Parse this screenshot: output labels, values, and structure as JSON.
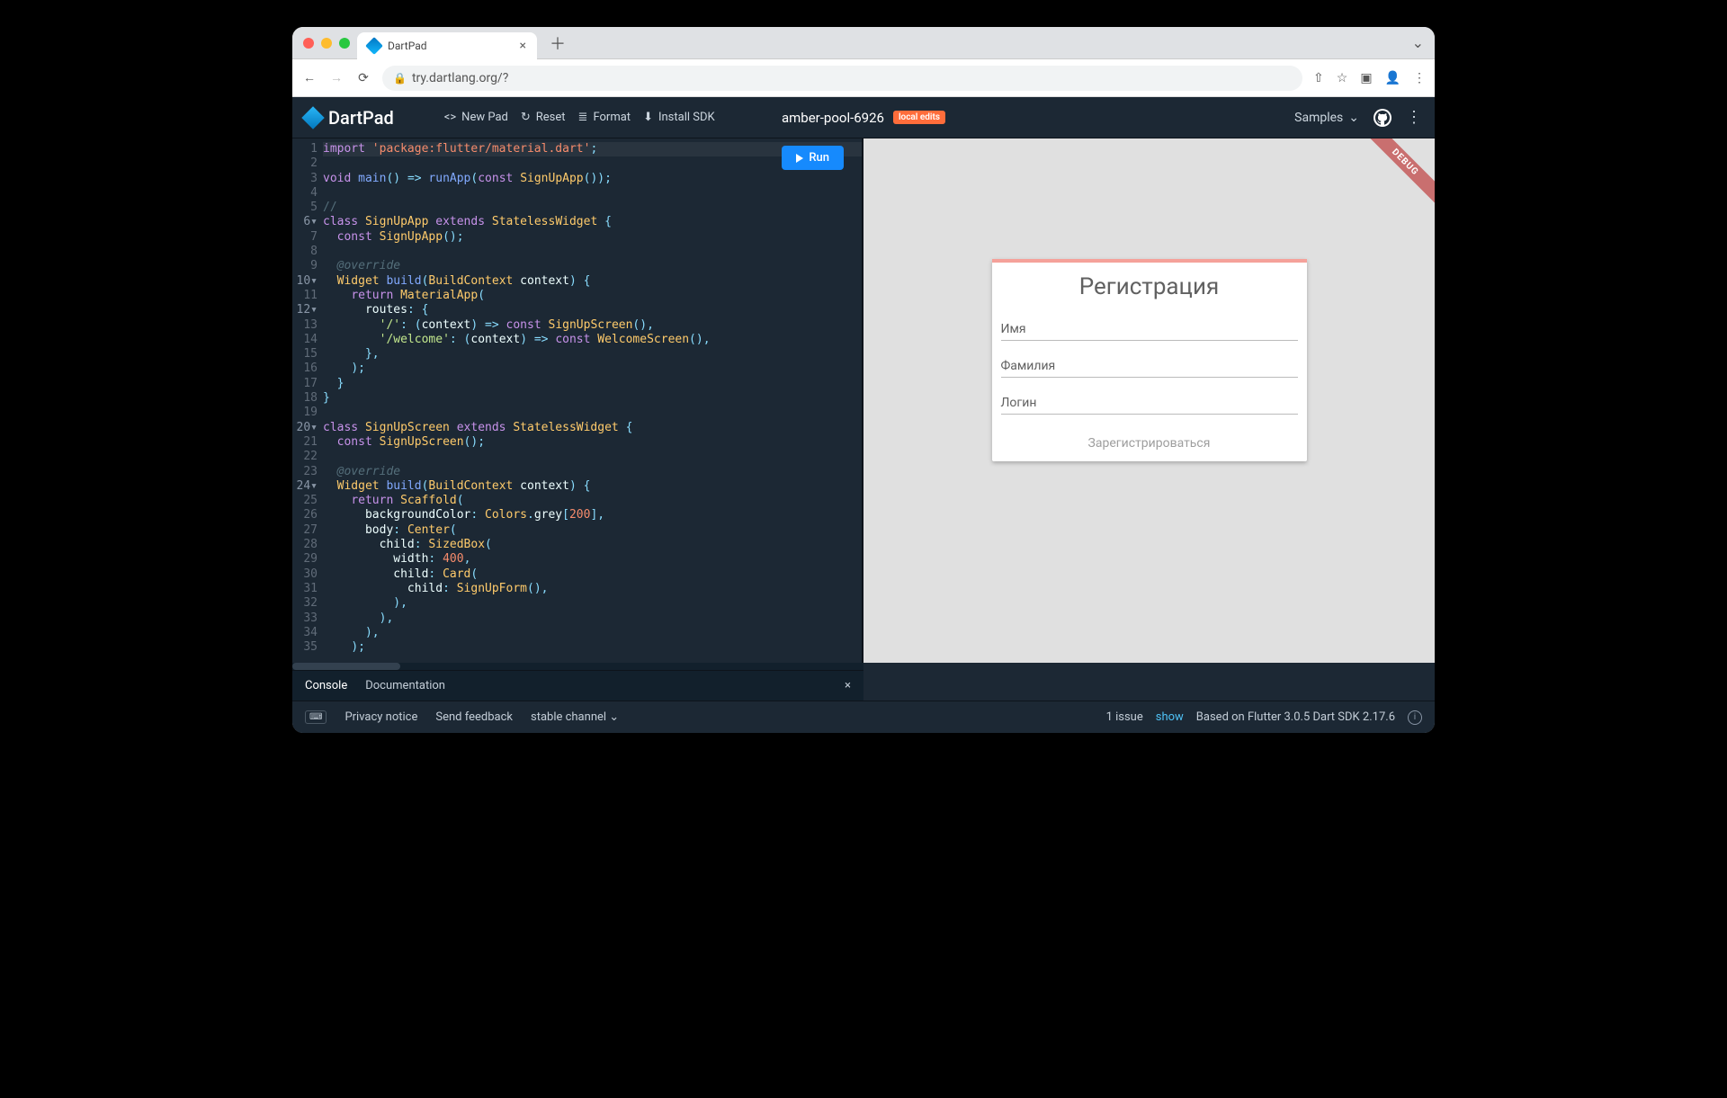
{
  "browser": {
    "tab_title": "DartPad",
    "url_display": "try.dartlang.org/?"
  },
  "toolbar": {
    "app_name": "DartPad",
    "new_pad": "New Pad",
    "reset": "Reset",
    "format": "Format",
    "install_sdk": "Install SDK",
    "project_name": "amber-pool-6926",
    "local_edits_badge": "local edits",
    "samples": "Samples",
    "run_label": "Run"
  },
  "editor": {
    "line_count": 35,
    "fold_lines": [
      6,
      10,
      12,
      20,
      24
    ],
    "code_lines": [
      {
        "raw": "import 'package:flutter/material.dart';",
        "seg": [
          [
            "kw",
            "import "
          ],
          [
            "strimp",
            "'package:flutter/material.dart'"
          ],
          [
            "pun",
            ";"
          ]
        ]
      },
      {
        "raw": ""
      },
      {
        "raw": "void main() => runApp(const SignUpApp());",
        "seg": [
          [
            "kw",
            "void "
          ],
          [
            "fn",
            "main"
          ],
          [
            "pun",
            "() "
          ],
          [
            "pun",
            "=> "
          ],
          [
            "fn",
            "runApp"
          ],
          [
            "pun",
            "("
          ],
          [
            "kw",
            "const "
          ],
          [
            "typ",
            "SignUpApp"
          ],
          [
            "pun",
            "());"
          ]
        ]
      },
      {
        "raw": ""
      },
      {
        "raw": "//",
        "seg": [
          [
            "cmt",
            "//"
          ]
        ]
      },
      {
        "raw": "class SignUpApp extends StatelessWidget {",
        "seg": [
          [
            "kw",
            "class "
          ],
          [
            "typ",
            "SignUpApp "
          ],
          [
            "kw",
            "extends "
          ],
          [
            "typ",
            "StatelessWidget "
          ],
          [
            "pun",
            "{"
          ]
        ]
      },
      {
        "raw": "  const SignUpApp();",
        "seg": [
          [
            "id",
            "  "
          ],
          [
            "kw",
            "const "
          ],
          [
            "typ",
            "SignUpApp"
          ],
          [
            "pun",
            "();"
          ]
        ]
      },
      {
        "raw": ""
      },
      {
        "raw": "  @override",
        "seg": [
          [
            "id",
            "  "
          ],
          [
            "ann",
            "@override"
          ]
        ]
      },
      {
        "raw": "  Widget build(BuildContext context) {",
        "seg": [
          [
            "id",
            "  "
          ],
          [
            "typ",
            "Widget "
          ],
          [
            "fn",
            "build"
          ],
          [
            "pun",
            "("
          ],
          [
            "typ",
            "BuildContext "
          ],
          [
            "id",
            "context"
          ],
          [
            "pun",
            ") {"
          ]
        ]
      },
      {
        "raw": "    return MaterialApp(",
        "seg": [
          [
            "id",
            "    "
          ],
          [
            "kw",
            "return "
          ],
          [
            "typ",
            "MaterialApp"
          ],
          [
            "pun",
            "("
          ]
        ]
      },
      {
        "raw": "      routes: {",
        "seg": [
          [
            "id",
            "      "
          ],
          [
            "id",
            "routes"
          ],
          [
            "pun",
            ": {"
          ]
        ]
      },
      {
        "raw": "        '/': (context) => const SignUpScreen(),",
        "seg": [
          [
            "id",
            "        "
          ],
          [
            "str",
            "'/'"
          ],
          [
            "pun",
            ": ("
          ],
          [
            "id",
            "context"
          ],
          [
            "pun",
            ") "
          ],
          [
            "pun",
            "=> "
          ],
          [
            "kw",
            "const "
          ],
          [
            "typ",
            "SignUpScreen"
          ],
          [
            "pun",
            "(),"
          ]
        ]
      },
      {
        "raw": "        '/welcome': (context) => const WelcomeScreen(),",
        "seg": [
          [
            "id",
            "        "
          ],
          [
            "str",
            "'/welcome'"
          ],
          [
            "pun",
            ": ("
          ],
          [
            "id",
            "context"
          ],
          [
            "pun",
            ") "
          ],
          [
            "pun",
            "=> "
          ],
          [
            "kw",
            "const "
          ],
          [
            "typ",
            "WelcomeScreen"
          ],
          [
            "pun",
            "(),"
          ]
        ]
      },
      {
        "raw": "      },",
        "seg": [
          [
            "id",
            "      "
          ],
          [
            "pun",
            "},"
          ]
        ]
      },
      {
        "raw": "    );",
        "seg": [
          [
            "id",
            "    "
          ],
          [
            "pun",
            ");"
          ]
        ]
      },
      {
        "raw": "  }",
        "seg": [
          [
            "id",
            "  "
          ],
          [
            "pun",
            "}"
          ]
        ]
      },
      {
        "raw": "}",
        "seg": [
          [
            "pun",
            "}"
          ]
        ]
      },
      {
        "raw": ""
      },
      {
        "raw": "class SignUpScreen extends StatelessWidget {",
        "seg": [
          [
            "kw",
            "class "
          ],
          [
            "typ",
            "SignUpScreen "
          ],
          [
            "kw",
            "extends "
          ],
          [
            "typ",
            "StatelessWidget "
          ],
          [
            "pun",
            "{"
          ]
        ]
      },
      {
        "raw": "  const SignUpScreen();",
        "seg": [
          [
            "id",
            "  "
          ],
          [
            "kw",
            "const "
          ],
          [
            "typ",
            "SignUpScreen"
          ],
          [
            "pun",
            "();"
          ]
        ]
      },
      {
        "raw": ""
      },
      {
        "raw": "  @override",
        "seg": [
          [
            "id",
            "  "
          ],
          [
            "ann",
            "@override"
          ]
        ]
      },
      {
        "raw": "  Widget build(BuildContext context) {",
        "seg": [
          [
            "id",
            "  "
          ],
          [
            "typ",
            "Widget "
          ],
          [
            "fn",
            "build"
          ],
          [
            "pun",
            "("
          ],
          [
            "typ",
            "BuildContext "
          ],
          [
            "id",
            "context"
          ],
          [
            "pun",
            ") {"
          ]
        ]
      },
      {
        "raw": "    return Scaffold(",
        "seg": [
          [
            "id",
            "    "
          ],
          [
            "kw",
            "return "
          ],
          [
            "typ",
            "Scaffold"
          ],
          [
            "pun",
            "("
          ]
        ]
      },
      {
        "raw": "      backgroundColor: Colors.grey[200],",
        "seg": [
          [
            "id",
            "      "
          ],
          [
            "id",
            "backgroundColor"
          ],
          [
            "pun",
            ": "
          ],
          [
            "typ",
            "Colors"
          ],
          [
            "pun",
            "."
          ],
          [
            "id",
            "grey"
          ],
          [
            "pun",
            "["
          ],
          [
            "num",
            "200"
          ],
          [
            "pun",
            "],"
          ]
        ]
      },
      {
        "raw": "      body: Center(",
        "seg": [
          [
            "id",
            "      "
          ],
          [
            "id",
            "body"
          ],
          [
            "pun",
            ": "
          ],
          [
            "typ",
            "Center"
          ],
          [
            "pun",
            "("
          ]
        ]
      },
      {
        "raw": "        child: SizedBox(",
        "seg": [
          [
            "id",
            "        "
          ],
          [
            "id",
            "child"
          ],
          [
            "pun",
            ": "
          ],
          [
            "typ",
            "SizedBox"
          ],
          [
            "pun",
            "("
          ]
        ]
      },
      {
        "raw": "          width: 400,",
        "seg": [
          [
            "id",
            "          "
          ],
          [
            "id",
            "width"
          ],
          [
            "pun",
            ": "
          ],
          [
            "num",
            "400"
          ],
          [
            "pun",
            ","
          ]
        ]
      },
      {
        "raw": "          child: Card(",
        "seg": [
          [
            "id",
            "          "
          ],
          [
            "id",
            "child"
          ],
          [
            "pun",
            ": "
          ],
          [
            "typ",
            "Card"
          ],
          [
            "pun",
            "("
          ]
        ]
      },
      {
        "raw": "            child: SignUpForm(),",
        "seg": [
          [
            "id",
            "            "
          ],
          [
            "id",
            "child"
          ],
          [
            "pun",
            ": "
          ],
          [
            "typ",
            "SignUpForm"
          ],
          [
            "pun",
            "(),"
          ]
        ]
      },
      {
        "raw": "          ),",
        "seg": [
          [
            "id",
            "          "
          ],
          [
            "pun",
            "),"
          ]
        ]
      },
      {
        "raw": "        ),",
        "seg": [
          [
            "id",
            "        "
          ],
          [
            "pun",
            "),"
          ]
        ]
      },
      {
        "raw": "      ),",
        "seg": [
          [
            "id",
            "      "
          ],
          [
            "pun",
            "),"
          ]
        ]
      },
      {
        "raw": "    );",
        "seg": [
          [
            "id",
            "    "
          ],
          [
            "pun",
            ");"
          ]
        ]
      }
    ]
  },
  "preview": {
    "debug_ribbon": "DEBUG",
    "card_title": "Регистрация",
    "field_name": "Имя",
    "field_surname": "Фамилия",
    "field_login": "Логин",
    "submit": "Зарегистрироваться"
  },
  "bottom_tabs": {
    "console": "Console",
    "documentation": "Documentation"
  },
  "status": {
    "privacy": "Privacy notice",
    "feedback": "Send feedback",
    "channel": "stable channel",
    "issues_count": "1 issue",
    "show_link": "show",
    "sdk_info": "Based on Flutter 3.0.5 Dart SDK 2.17.6"
  }
}
